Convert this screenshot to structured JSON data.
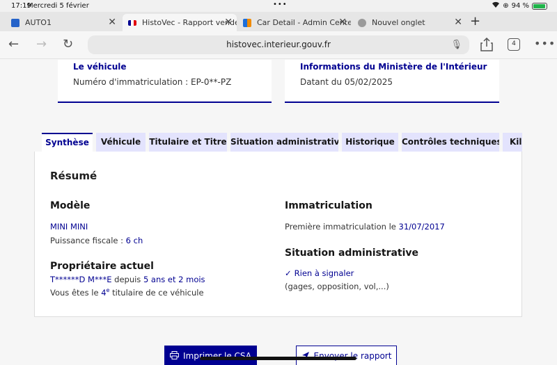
{
  "status": {
    "time": "17:19",
    "date": "Mercredi 5 février",
    "battery": "94 %",
    "battery_level": 0.94,
    "battery_color": "#1fb44a"
  },
  "tabs": [
    {
      "label": "AUTO1",
      "active": false
    },
    {
      "label": "HistoVec - Rapport vendeur",
      "active": true
    },
    {
      "label": "Car Detail - Admin Center",
      "active": false
    },
    {
      "label": "Nouvel onglet",
      "active": false
    }
  ],
  "address": {
    "url": "histovec.interieur.gouv.fr",
    "tab_count": "4"
  },
  "info_cards": [
    {
      "title": "Le véhicule",
      "text": "Numéro d'immatriculation : EP-0**-PZ"
    },
    {
      "title": "Informations du Ministère de l'Intérieur",
      "text": "Datant du 05/02/2025"
    }
  ],
  "page_tabs": [
    "Synthèse",
    "Véhicule",
    "Titulaire et Titre",
    "Situation administrative",
    "Historique",
    "Contrôles techniques",
    "Kilo"
  ],
  "summary": {
    "heading": "Résumé",
    "model": {
      "label": "Modèle",
      "name": "MINI MINI",
      "power_label": "Puissance fiscale : ",
      "power": "6 ch"
    },
    "owner": {
      "label": "Propriétaire actuel",
      "name": "T******D M***E",
      "since_label": " depuis ",
      "since": "5 ans et 2 mois",
      "rank_prefix": "Vous êtes le ",
      "rank_num": "4",
      "rank_sup": "e",
      "rank_suffix": " titulaire de ce véhicule"
    },
    "registration": {
      "label": "Immatriculation",
      "first_label": "Première immatriculation le ",
      "first_date": "31/07/2017"
    },
    "admin": {
      "label": "Situation administrative",
      "status": "Rien à signaler",
      "details": "(gages, opposition, vol,...)"
    }
  },
  "actions": {
    "print": "Imprimer le CSA",
    "send": "Envoyer le rapport"
  },
  "colors": {
    "accent": "#000091",
    "tab_bg": "#e3e3fd"
  }
}
